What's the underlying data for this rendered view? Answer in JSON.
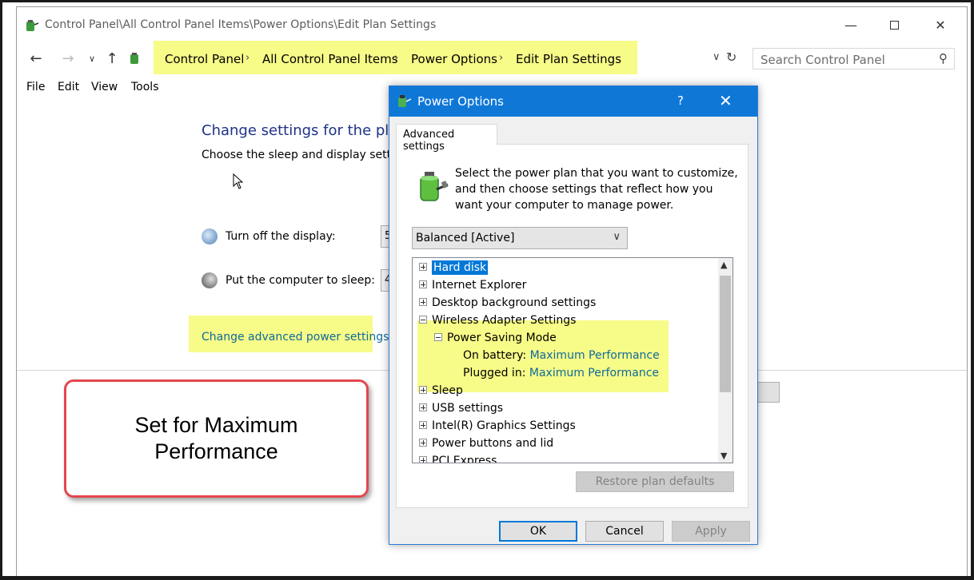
{
  "window": {
    "title": "Control Panel\\All Control Panel Items\\Power Options\\Edit Plan Settings",
    "minimize_icon": "minimize-icon",
    "maximize_icon": "maximize-icon",
    "close_icon": "close-icon"
  },
  "address": {
    "breadcrumbs": [
      "Control Panel",
      "All Control Panel Items",
      "Power Options",
      "Edit Plan Settings"
    ],
    "search_placeholder": "Search Control Panel"
  },
  "menu": [
    "File",
    "Edit",
    "View",
    "Tools"
  ],
  "main": {
    "heading": "Change settings for the pla",
    "subtext": "Choose the sleep and display settin",
    "display_label": "Turn off the display:",
    "display_value_stub": "5",
    "sleep_label": "Put the computer to sleep:",
    "sleep_value_stub": "4",
    "advanced_link": "Change advanced power settings"
  },
  "callout": {
    "text": "Set for Maximum Performance"
  },
  "dialog": {
    "title": "Power Options",
    "help": "?",
    "close": "✕",
    "tab": "Advanced settings",
    "intro": "Select the power plan that you want to customize, and then choose settings that reflect how you want your computer to manage power.",
    "plan": "Balanced [Active]",
    "tree": {
      "hard_disk": "Hard disk",
      "internet_explorer": "Internet Explorer",
      "desktop_background": "Desktop background settings",
      "wireless": "Wireless Adapter Settings",
      "power_saving": "Power Saving Mode",
      "on_battery_label": "On battery:",
      "on_battery_value": "Maximum Performance",
      "plugged_in_label": "Plugged in:",
      "plugged_in_value": "Maximum Performance",
      "sleep": "Sleep",
      "usb": "USB settings",
      "intel": "Intel(R) Graphics Settings",
      "power_buttons": "Power buttons and lid",
      "pci": "PCI Express"
    },
    "restore": "Restore plan defaults",
    "ok": "OK",
    "cancel": "Cancel",
    "apply": "Apply"
  },
  "colors": {
    "highlight": "#f7fb87",
    "dialog_title": "#0f78d7",
    "link": "#0f6a9c",
    "heading": "#1e3287",
    "callout_border": "#e4474e"
  }
}
